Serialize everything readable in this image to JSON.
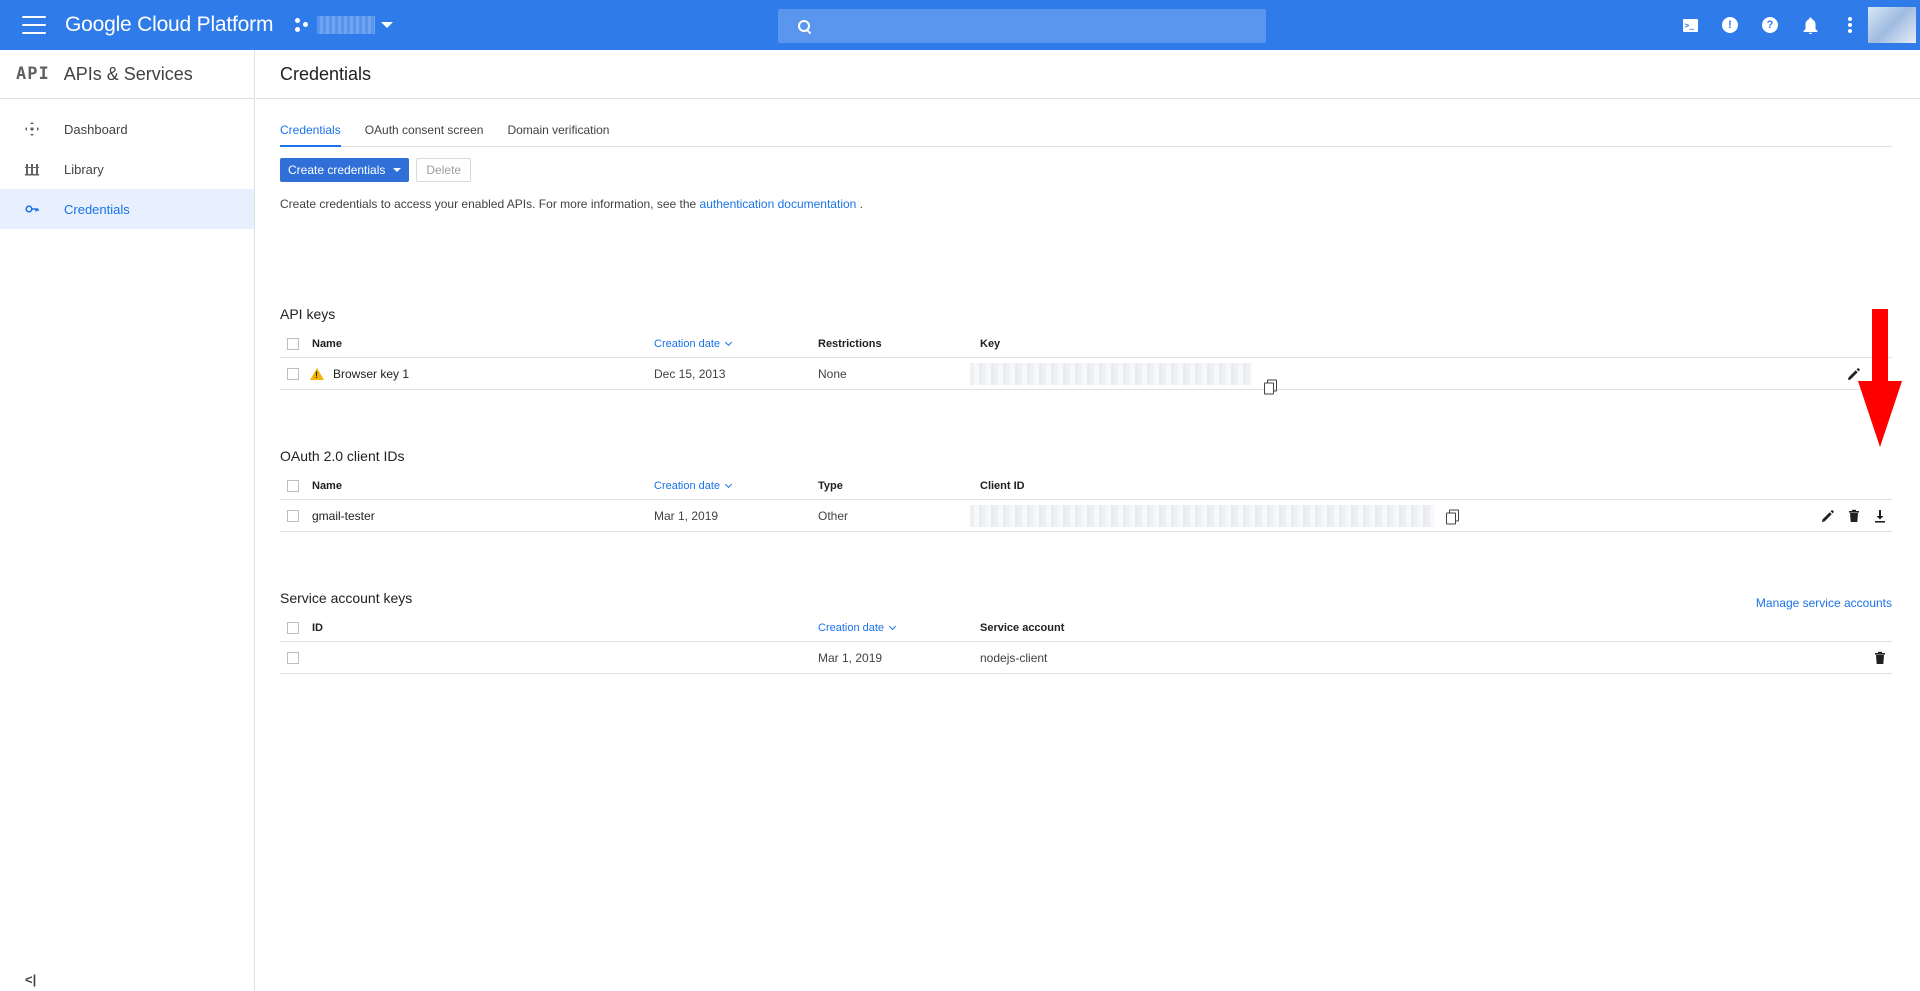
{
  "topbar": {
    "brand": "Google Cloud Platform",
    "search_placeholder": ""
  },
  "sidebar": {
    "logo": "API",
    "title": "APIs & Services",
    "items": [
      {
        "label": "Dashboard",
        "icon": "dashboard-icon"
      },
      {
        "label": "Library",
        "icon": "library-icon"
      },
      {
        "label": "Credentials",
        "icon": "key-icon",
        "active": true
      }
    ],
    "collapse_label": "<|"
  },
  "page": {
    "title": "Credentials",
    "tabs": [
      {
        "label": "Credentials",
        "active": true
      },
      {
        "label": "OAuth consent screen"
      },
      {
        "label": "Domain verification"
      }
    ],
    "create_button": "Create credentials",
    "delete_button": "Delete",
    "intro_text": "Create credentials to access your enabled APIs. For more information, see the ",
    "intro_link": "authentication documentation",
    "intro_end": " ."
  },
  "api_keys": {
    "title": "API keys",
    "headers": {
      "name": "Name",
      "date": "Creation date",
      "restrictions": "Restrictions",
      "key": "Key"
    },
    "rows": [
      {
        "name": "Browser key 1",
        "date": "Dec 15, 2013",
        "restrictions": "None"
      }
    ]
  },
  "oauth": {
    "title": "OAuth 2.0 client IDs",
    "headers": {
      "name": "Name",
      "date": "Creation date",
      "type": "Type",
      "client_id": "Client ID"
    },
    "rows": [
      {
        "name": "gmail-tester",
        "date": "Mar 1, 2019",
        "type": "Other"
      }
    ]
  },
  "service_keys": {
    "title": "Service account keys",
    "manage_link": "Manage service accounts",
    "headers": {
      "id": "ID",
      "date": "Creation date",
      "account": "Service account"
    },
    "rows": [
      {
        "id": "",
        "date": "Mar 1, 2019",
        "account": "nodejs-client"
      }
    ]
  },
  "colors": {
    "topbar": "#2f7be9",
    "accent": "#1a73e8",
    "annotation_arrow": "#ff0000",
    "warning": "#f4b400"
  }
}
